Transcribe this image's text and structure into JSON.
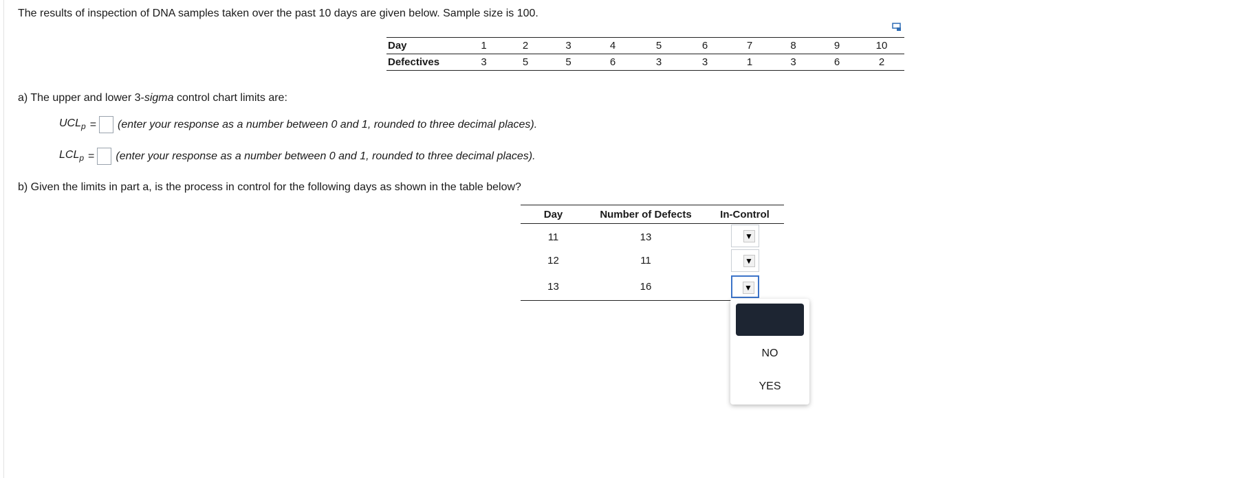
{
  "intro": "The results of inspection of DNA samples taken over the past 10 days are given below. Sample size is 100.",
  "copy_icon": "copy-table-icon",
  "table1": {
    "row_label_day": "Day",
    "row_label_def": "Defectives",
    "days": [
      "1",
      "2",
      "3",
      "4",
      "5",
      "6",
      "7",
      "8",
      "9",
      "10"
    ],
    "defectives": [
      "3",
      "5",
      "5",
      "6",
      "3",
      "3",
      "1",
      "3",
      "6",
      "2"
    ]
  },
  "part_a": {
    "prompt_pre": "a) The upper and lower 3-",
    "prompt_sigma": "sigma",
    "prompt_post": " control chart limits are:",
    "ucl_main": "UCL",
    "ucl_sub": "p",
    "lcl_main": "LCL",
    "lcl_sub": "p",
    "eq": "=",
    "ucl_value": "",
    "lcl_value": "",
    "hint": "(enter your response as a number between 0 and 1, rounded to three decimal places)."
  },
  "part_b": {
    "prompt": "b) Given the limits in part a, is the process in control for the following days as shown in the table below?",
    "headers": [
      "Day",
      "Number of Defects",
      "In-Control"
    ],
    "rows": [
      {
        "day": "11",
        "defects": "13",
        "selected": ""
      },
      {
        "day": "12",
        "defects": "11",
        "selected": ""
      },
      {
        "day": "13",
        "defects": "16",
        "selected": ""
      }
    ],
    "arrow": "▼"
  },
  "dropdown_menu": {
    "options": [
      "",
      "NO",
      "YES"
    ]
  }
}
